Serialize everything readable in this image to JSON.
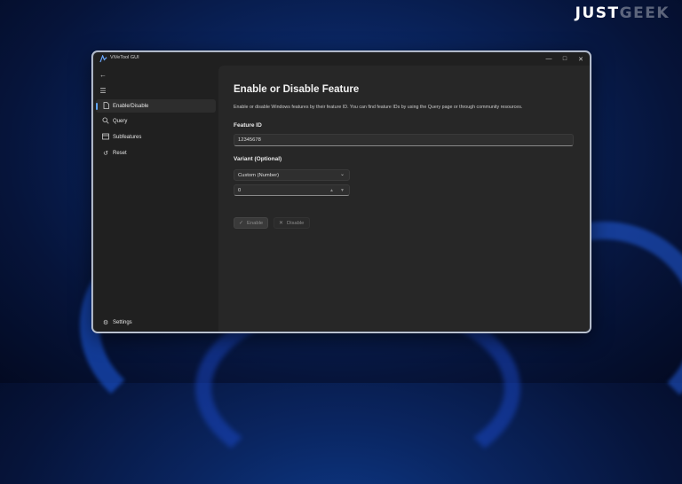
{
  "watermark": {
    "part1": "JUST",
    "part2": "GEEK"
  },
  "window": {
    "title": "ViVeTool GUI"
  },
  "sidebar": {
    "items": [
      {
        "label": "Enable/Disable",
        "icon": "document-icon"
      },
      {
        "label": "Query",
        "icon": "search-icon"
      },
      {
        "label": "Subfeatures",
        "icon": "subfeatures-icon"
      },
      {
        "label": "Reset",
        "icon": "reset-icon"
      }
    ],
    "settings": {
      "label": "Settings",
      "icon": "gear-icon"
    }
  },
  "main": {
    "title": "Enable or Disable Feature",
    "description": "Enable or disable Windows features by their feature ID. You can find feature IDs by using the Query page or through community resources.",
    "feature_id": {
      "label": "Feature ID",
      "value": "12345678"
    },
    "variant": {
      "label": "Variant (Optional)",
      "dropdown_value": "Custom (Number)",
      "number_value": "0"
    },
    "buttons": {
      "enable": "Enable",
      "disable": "Disable"
    }
  },
  "colors": {
    "accent": "#60a5fa",
    "window_bg": "#202020",
    "content_bg": "#272727"
  }
}
